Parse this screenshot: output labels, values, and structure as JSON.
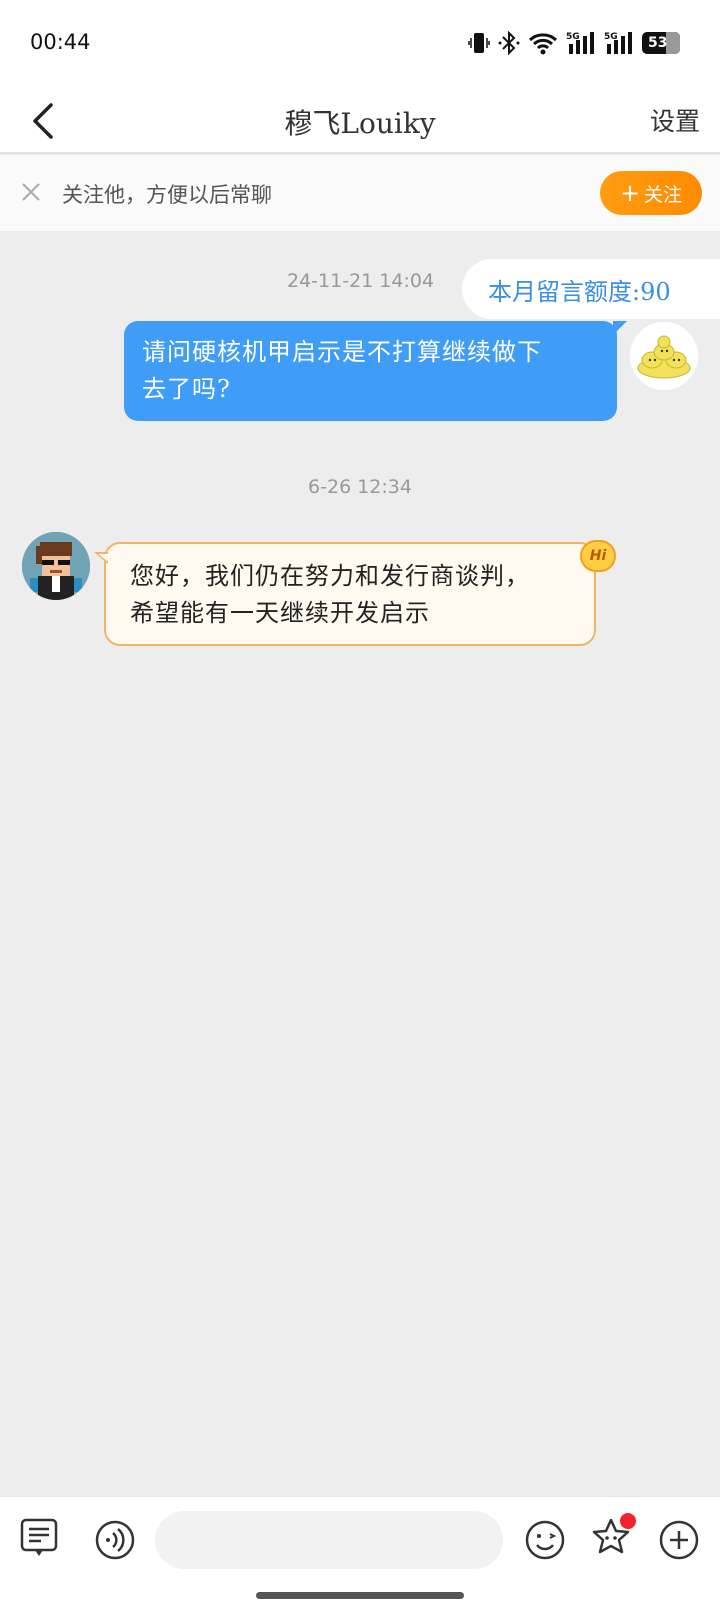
{
  "status_bar": {
    "time": "00:44",
    "battery": "53",
    "icons": [
      "vibrate-icon",
      "bluetooth-icon",
      "wifi-icon",
      "5g-signal-icon",
      "5g-signal-icon",
      "battery-icon"
    ]
  },
  "nav": {
    "title": "穆飞Louiky",
    "settings_label": "设置",
    "back_icon": "chevron-left-icon"
  },
  "follow_bar": {
    "text": "关注他，方便以后常聊",
    "button_plus": "+",
    "button_label": "关注",
    "accent": "#ff9a0f"
  },
  "quota": {
    "text": "本月留言额度:90"
  },
  "messages": [
    {
      "timestamp": "24-11-21 14:04",
      "sender": "me",
      "lines": [
        "请问硬核机甲启示是不打算继续做下",
        "去了吗?"
      ],
      "color": "#3f9cf7"
    },
    {
      "timestamp": "6-26 12:34",
      "sender": "other",
      "lines": [
        "您好，我们仍在努力和发行商谈判，",
        "希望能有一天继续开发启示"
      ],
      "badge": "Hi",
      "color": "#fff9ef"
    }
  ],
  "toolbar": {
    "icons": [
      "message-list-icon",
      "voice-icon",
      "emoji-icon",
      "sticker-star-icon",
      "plus-circle-icon"
    ],
    "input_placeholder": ""
  }
}
